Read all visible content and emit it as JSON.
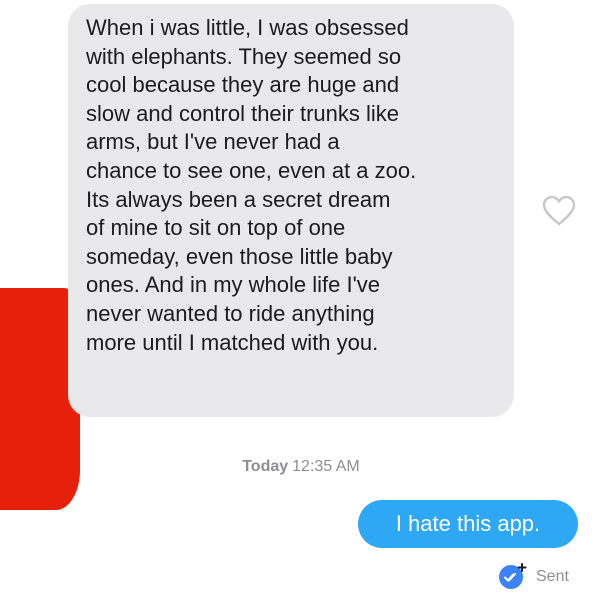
{
  "conversation": {
    "incoming_message": {
      "text": "When i was little, I was obsessed\nwith elephants. They seemed so\ncool because they are huge and\nslow and control their trunks like\narms, but I've never had a\nchance to see one, even at a zoo.\nIts always been a secret dream\nof mine to sit on top of one\nsomeday, even those little baby\nones. And in my whole life I've\nnever wanted to ride anything\nmore until I matched with you."
    },
    "timestamp": {
      "day": "Today",
      "time": "12:35 AM"
    },
    "outgoing_message": {
      "text": "I hate this app."
    },
    "status": "Sent"
  },
  "icons": {
    "like": "heart-outline-icon",
    "read_receipt": "blue-check-plus-icon"
  },
  "colors": {
    "incoming_bubble": "#e9e9eb",
    "outgoing_bubble": "#2ea8f5",
    "redaction": "#e5210c",
    "meta_text": "#8e8e93",
    "receipt_badge": "#3b83f7"
  }
}
